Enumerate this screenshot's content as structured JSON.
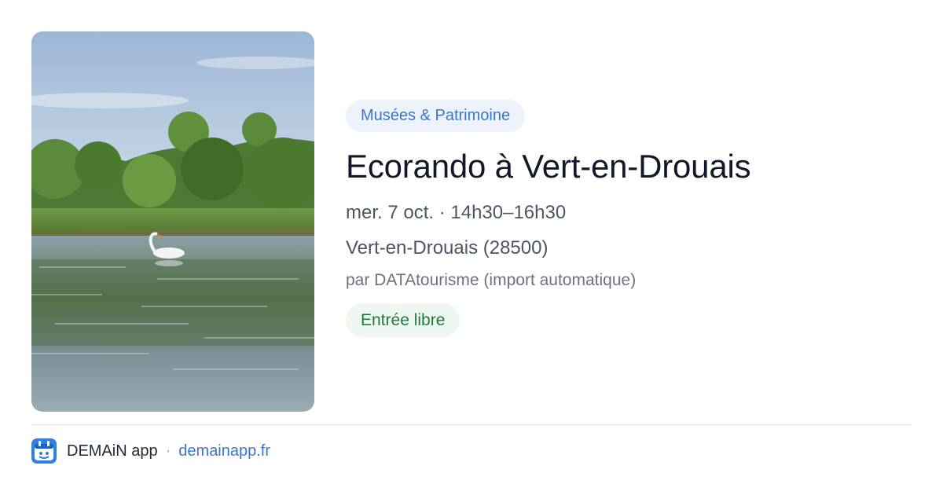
{
  "event": {
    "category": "Musées & Patrimoine",
    "title": "Ecorando à Vert-en-Drouais",
    "when": "mer. 7 oct. · 14h30–16h30",
    "where": "Vert-en-Drouais (28500)",
    "organizer": "par DATAtourisme (import automatique)",
    "price": "Entrée libre"
  },
  "footer": {
    "brand": "DEMAiN app",
    "separator": "·",
    "site": "demainapp.fr"
  },
  "colors": {
    "accent": "#3a76c9",
    "category_bg": "#eef3fb",
    "price_text": "#1f7a3d",
    "price_bg": "#eef8f0"
  },
  "icons": {
    "app": "demain-app-icon"
  }
}
